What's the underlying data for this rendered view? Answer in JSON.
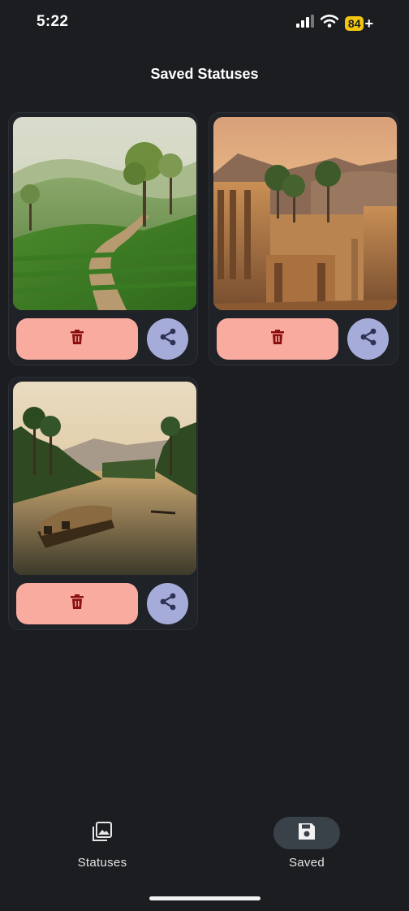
{
  "status_bar": {
    "time": "5:22",
    "battery": "84"
  },
  "header": {
    "title": "Saved Statuses"
  },
  "cards": [
    {
      "image": "tea plantation hills with trees and winding path"
    },
    {
      "image": "ancient stone temple ruins at sunset with palm trees"
    },
    {
      "image": "houseboat on palm-lined backwaters at dusk"
    }
  ],
  "bottom_nav": {
    "items": [
      {
        "label": "Statuses",
        "icon": "gallery-icon",
        "active": false
      },
      {
        "label": "Saved",
        "icon": "save-icon",
        "active": true
      }
    ]
  },
  "colors": {
    "background": "#1b1d21",
    "delete_button": "#f9aba0",
    "share_button": "#a6acd9",
    "active_nav_pill": "#3a4249",
    "battery": "#f1c40f"
  }
}
